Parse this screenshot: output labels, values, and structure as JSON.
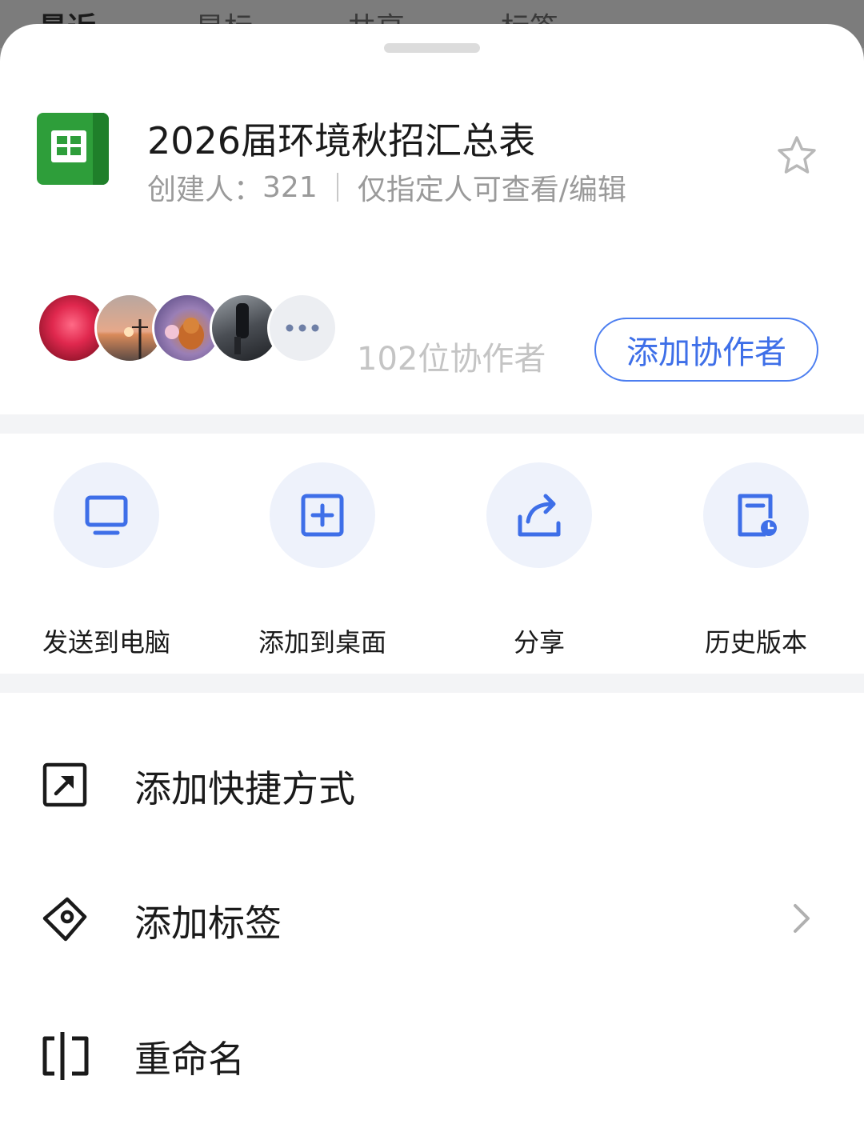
{
  "background_tabs": [
    "最近",
    "星标",
    "共享",
    "标签"
  ],
  "file": {
    "title": "2026届环境秋招汇总表",
    "creator_label": "创建人：",
    "creator_value": "321",
    "permission": "仅指定人可查看/编辑",
    "icon": "spreadsheet-icon",
    "star_icon": "star-icon"
  },
  "collaborators": {
    "count_text": "102位协作者",
    "add_button": "添加协作者",
    "more_icon": "ellipsis-icon"
  },
  "actions": [
    {
      "label": "发送到电脑",
      "icon": "monitor-icon"
    },
    {
      "label": "添加到桌面",
      "icon": "add-square-icon"
    },
    {
      "label": "分享",
      "icon": "share-icon"
    },
    {
      "label": "历史版本",
      "icon": "history-icon"
    }
  ],
  "menu": [
    {
      "label": "添加快捷方式",
      "icon": "shortcut-icon"
    },
    {
      "label": "添加标签",
      "icon": "tag-icon",
      "chevron": "chevron-right-icon"
    },
    {
      "label": "重命名",
      "icon": "rename-icon"
    }
  ],
  "colors": {
    "accent": "#3e6fe8",
    "sheet_green": "#2e9e3a",
    "text": "#1a1a1a",
    "muted": "#9a9a9a"
  }
}
